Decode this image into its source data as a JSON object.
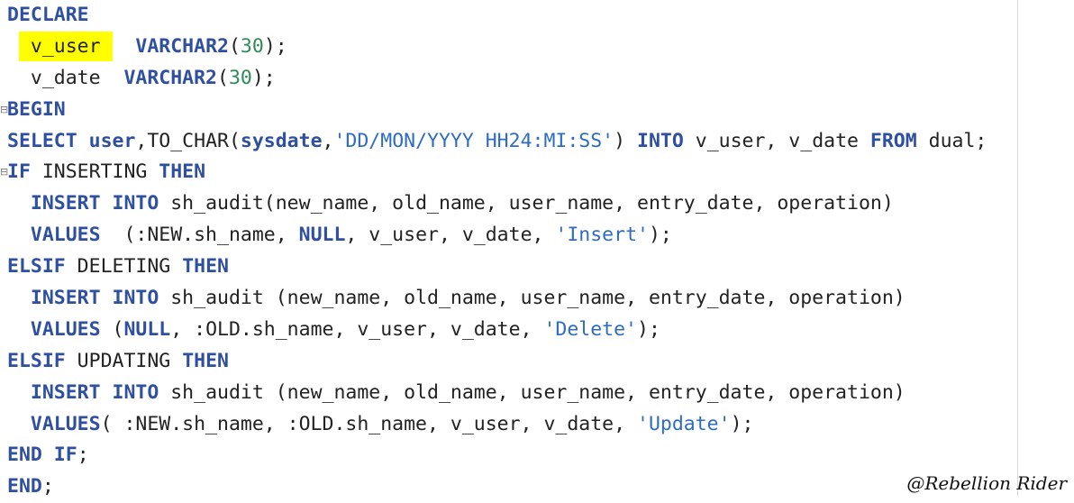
{
  "editor": {
    "lines": [
      {
        "tokens": [
          [
            "kw",
            "DECLARE"
          ]
        ]
      },
      {
        "indent": " ",
        "highlight": " v_user ",
        "tokens": [
          [
            "plain",
            "  "
          ],
          [
            "kw",
            "VARCHAR2"
          ],
          [
            "plain",
            "("
          ],
          [
            "num",
            "30"
          ],
          [
            "plain",
            ");"
          ]
        ]
      },
      {
        "tokens": [
          [
            "plain",
            "  v_date  "
          ],
          [
            "kw",
            "VARCHAR2"
          ],
          [
            "plain",
            "("
          ],
          [
            "num",
            "30"
          ],
          [
            "plain",
            ");"
          ]
        ]
      },
      {
        "fold": true,
        "tokens": [
          [
            "kw",
            "BEGIN"
          ]
        ]
      },
      {
        "tokens": [
          [
            "kw",
            "SELECT"
          ],
          [
            "plain",
            " "
          ],
          [
            "kw",
            "user"
          ],
          [
            "plain",
            ",TO_CHAR("
          ],
          [
            "kw",
            "sysdate"
          ],
          [
            "plain",
            ","
          ],
          [
            "str",
            "'DD/MON/YYYY HH24:MI:SS'"
          ],
          [
            "plain",
            ") "
          ],
          [
            "kw",
            "INTO"
          ],
          [
            "plain",
            " v_user, v_date "
          ],
          [
            "kw",
            "FROM"
          ],
          [
            "plain",
            " dual;"
          ]
        ]
      },
      {
        "fold": true,
        "tokens": [
          [
            "kw",
            "IF"
          ],
          [
            "plain",
            " INSERTING "
          ],
          [
            "kw",
            "THEN"
          ]
        ]
      },
      {
        "tokens": [
          [
            "plain",
            "  "
          ],
          [
            "kw",
            "INSERT"
          ],
          [
            "plain",
            " "
          ],
          [
            "kw",
            "INTO"
          ],
          [
            "plain",
            " sh_audit(new_name, old_name, user_name, entry_date, operation)"
          ]
        ]
      },
      {
        "tokens": [
          [
            "plain",
            "  "
          ],
          [
            "kw",
            "VALUES"
          ],
          [
            "plain",
            "  (:NEW.sh_name, "
          ],
          [
            "kw",
            "NULL"
          ],
          [
            "plain",
            ", v_user, v_date, "
          ],
          [
            "str",
            "'Insert'"
          ],
          [
            "plain",
            ");"
          ]
        ]
      },
      {
        "tokens": [
          [
            "kw",
            "ELSIF"
          ],
          [
            "plain",
            " DELETING "
          ],
          [
            "kw",
            "THEN"
          ]
        ]
      },
      {
        "tokens": [
          [
            "plain",
            "  "
          ],
          [
            "kw",
            "INSERT"
          ],
          [
            "plain",
            " "
          ],
          [
            "kw",
            "INTO"
          ],
          [
            "plain",
            " sh_audit (new_name, old_name, user_name, entry_date, operation)"
          ]
        ]
      },
      {
        "tokens": [
          [
            "plain",
            "  "
          ],
          [
            "kw",
            "VALUES"
          ],
          [
            "plain",
            " ("
          ],
          [
            "kw",
            "NULL"
          ],
          [
            "plain",
            ", :OLD.sh_name, v_user, v_date, "
          ],
          [
            "str",
            "'Delete'"
          ],
          [
            "plain",
            ");"
          ]
        ]
      },
      {
        "tokens": [
          [
            "kw",
            "ELSIF"
          ],
          [
            "plain",
            " UPDATING "
          ],
          [
            "kw",
            "THEN"
          ]
        ]
      },
      {
        "tokens": [
          [
            "plain",
            "  "
          ],
          [
            "kw",
            "INSERT"
          ],
          [
            "plain",
            " "
          ],
          [
            "kw",
            "INTO"
          ],
          [
            "plain",
            " sh_audit (new_name, old_name, user_name, entry_date, operation)"
          ]
        ]
      },
      {
        "tokens": [
          [
            "plain",
            "  "
          ],
          [
            "kw",
            "VALUES"
          ],
          [
            "plain",
            "( :NEW.sh_name, :OLD.sh_name, v_user, v_date, "
          ],
          [
            "str",
            "'Update'"
          ],
          [
            "plain",
            ");"
          ]
        ]
      },
      {
        "tokens": [
          [
            "kw",
            "END"
          ],
          [
            "plain",
            " "
          ],
          [
            "kw",
            "IF"
          ],
          [
            "plain",
            ";"
          ]
        ]
      },
      {
        "tokens": [
          [
            "kw",
            "END"
          ],
          [
            "plain",
            ";"
          ]
        ]
      }
    ]
  },
  "watermark": "@Rebellion Rider",
  "colors": {
    "keyword": "#2f4fa0",
    "number": "#2e8b57",
    "string": "#2d6bc4",
    "highlight": "#ffff00"
  }
}
